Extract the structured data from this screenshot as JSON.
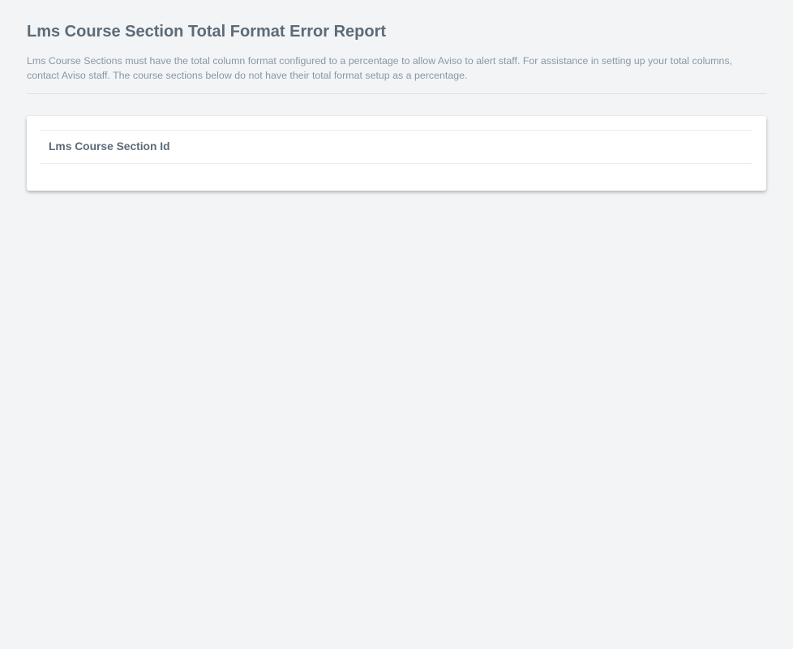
{
  "page": {
    "title": "Lms Course Section Total Format Error Report",
    "description": "Lms Course Sections must have the total column format configured to a percentage to allow Aviso to alert staff. For assistance in setting up your total columns, contact Aviso staff. The course sections below do not have their total format setup as a percentage."
  },
  "table": {
    "columns": [
      {
        "label": "Lms Course Section Id"
      }
    ],
    "rows": []
  },
  "colors": {
    "background": "#f3f4f6",
    "title": "#5b6b78",
    "description": "#8a98a6",
    "card": "#ffffff"
  }
}
